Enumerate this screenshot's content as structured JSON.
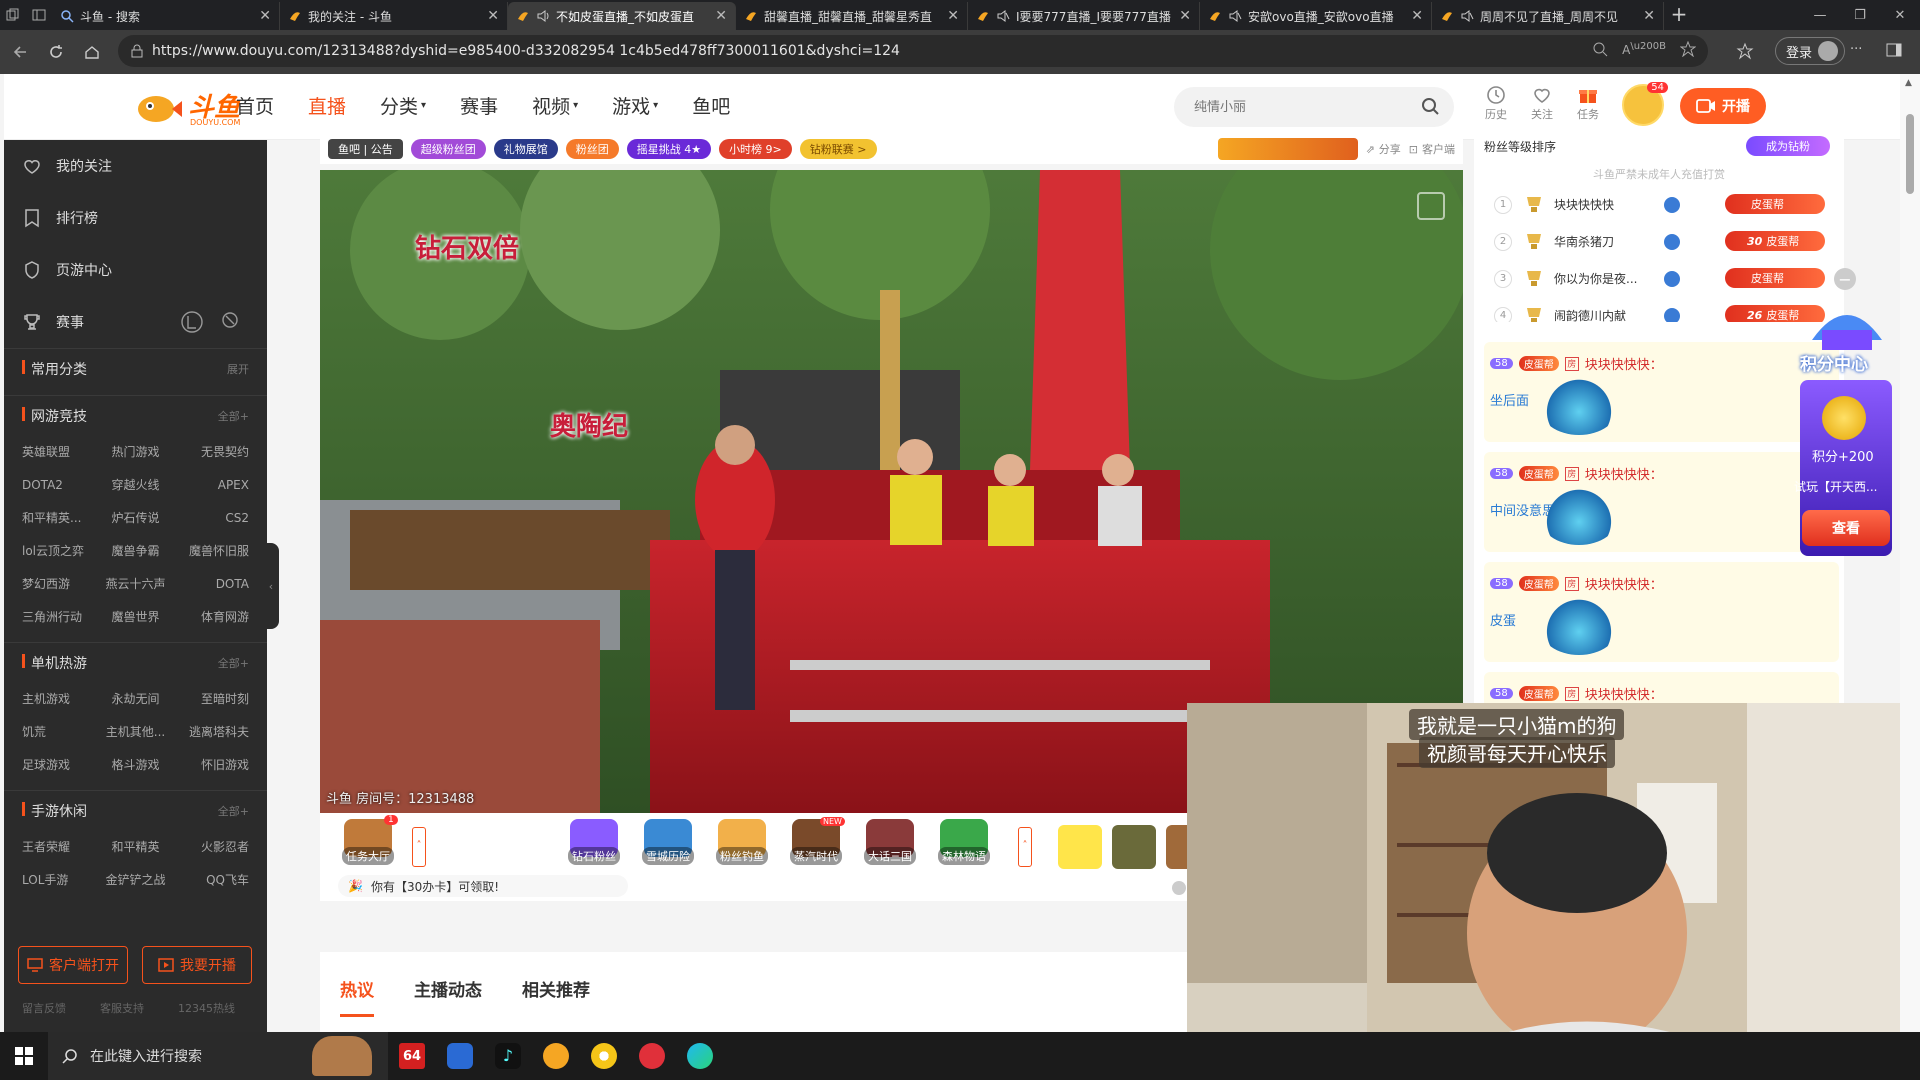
{
  "browser": {
    "tabs": [
      {
        "title": "斗鱼 - 搜索",
        "active": false
      },
      {
        "title": "我的关注 - 斗鱼",
        "active": false
      },
      {
        "title": "不如皮蛋直播_不如皮蛋直",
        "active": true
      },
      {
        "title": "甜馨直播_甜馨直播_甜馨星秀直",
        "active": false
      },
      {
        "title": "I要要777直播_I要要777直播",
        "active": false
      },
      {
        "title": "安歆ovo直播_安歆ovo直播",
        "active": false
      },
      {
        "title": "周周不见了直播_周周不见",
        "active": false
      }
    ],
    "url": "https://www.douyu.com/12313488?dyshid=e985400-d332082954 1c4b5ed478ff7300011601&dyshci=124",
    "login_label": "登录"
  },
  "site": {
    "logo_text": "斗鱼",
    "logo_sub": "DOUYU.COM",
    "nav": [
      {
        "label": "首页",
        "active": false,
        "caret": false
      },
      {
        "label": "直播",
        "active": true,
        "caret": false
      },
      {
        "label": "分类",
        "active": false,
        "caret": true
      },
      {
        "label": "赛事",
        "active": false,
        "caret": false
      },
      {
        "label": "视频",
        "active": false,
        "caret": true
      },
      {
        "label": "游戏",
        "active": false,
        "caret": true
      },
      {
        "label": "鱼吧",
        "active": false,
        "caret": false
      }
    ],
    "search_placeholder": "纯情小丽",
    "header_icons": [
      {
        "name": "history",
        "label": "历史"
      },
      {
        "name": "follow",
        "label": "关注"
      },
      {
        "name": "task",
        "label": "任务"
      }
    ],
    "avatar_badge": "54",
    "start_stream_label": "开播"
  },
  "sidebar": {
    "main_items": [
      {
        "name": "follow",
        "label": "我的关注"
      },
      {
        "name": "rank",
        "label": "排行榜"
      },
      {
        "name": "mobile-game",
        "label": "页游中心"
      },
      {
        "name": "match",
        "label": "赛事"
      }
    ],
    "common": {
      "title": "常用分类",
      "more": "展开"
    },
    "sections": [
      {
        "title": "网游竞技",
        "more": "全部+",
        "items": [
          "英雄联盟",
          "热门游戏",
          "无畏契约",
          "DOTA2",
          "穿越火线",
          "APEX",
          "和平精英...",
          "炉石传说",
          "CS2",
          "lol云顶之弈",
          "魔兽争霸",
          "魔兽怀旧服",
          "梦幻西游",
          "燕云十六声",
          "DOTA",
          "三角洲行动",
          "魔兽世界",
          "体育网游"
        ]
      },
      {
        "title": "单机热游",
        "more": "全部+",
        "items": [
          "主机游戏",
          "永劫无间",
          "至暗时刻",
          "饥荒",
          "主机其他...",
          "逃离塔科夫",
          "足球游戏",
          "格斗游戏",
          "怀旧游戏"
        ]
      },
      {
        "title": "手游休闲",
        "more": "全部+",
        "items": [
          "王者荣耀",
          "和平精英",
          "火影忍者",
          "LOL手游",
          "金铲铲之战",
          "QQ飞车"
        ]
      }
    ],
    "client_btn": "客户端打开",
    "start_btn": "我要开播",
    "footer": [
      "留言反馈",
      "客服支持",
      "12345热线"
    ]
  },
  "room": {
    "top_strip": {
      "fish_bar": "鱼吧",
      "notice": "公告",
      "pills": [
        "超级粉丝团",
        "礼物展馆",
        "粉丝团",
        "摇星挑战 4★",
        "小时榜 9>",
        "钻粉联赛 >"
      ],
      "share": "分享",
      "client": "客户端"
    },
    "video_caption_1": "钻石双倍",
    "video_caption_2": "奥陶纪",
    "room_no": "斗鱼 房间号：12313488",
    "gifts": [
      {
        "name": "task-hall",
        "label": "任务大厅",
        "color": "#c07a3a",
        "badge": "1"
      },
      {
        "name": "diamond-fans",
        "label": "钻石粉丝",
        "color": "#8a5cff"
      },
      {
        "name": "snow-city",
        "label": "雪城历险",
        "color": "#3a8ad4"
      },
      {
        "name": "fans-fishing",
        "label": "粉丝钓鱼",
        "color": "#f2b04a"
      },
      {
        "name": "steam-age",
        "label": "蒸汽时代",
        "color": "#7a4a2a",
        "badge": "NEW"
      },
      {
        "name": "three-kingdoms",
        "label": "大话三国",
        "color": "#8a3a3a"
      },
      {
        "name": "forest-story",
        "label": "森林物语",
        "color": "#3aa84a"
      }
    ],
    "claim_text": "你有【30办卡】可领取!",
    "content_tabs": [
      "热议",
      "主播动态",
      "相关推荐"
    ]
  },
  "rank_panel": {
    "title": "粉丝等级排序",
    "become_diamond": "成为钻粉",
    "note": "斗鱼严禁未成年人充值打赏",
    "rows": [
      {
        "rank": "1",
        "name": "块块快快快",
        "level": "",
        "fan_tag": "皮蛋帮"
      },
      {
        "rank": "2",
        "name": "华南杀猪刀",
        "level": "30",
        "fan_tag": "皮蛋帮"
      },
      {
        "rank": "3",
        "name": "你以为你是夜...",
        "level": "",
        "fan_tag": "皮蛋帮"
      },
      {
        "rank": "4",
        "name": "闹韵德川内献",
        "level": "26",
        "fan_tag": "皮蛋帮"
      }
    ]
  },
  "chat": [
    {
      "level": "58",
      "fan": "皮蛋帮",
      "user": "块块快快快：",
      "msg": "坐后面"
    },
    {
      "level": "58",
      "fan": "皮蛋帮",
      "user": "块块快快快：",
      "msg": "中间没意思"
    },
    {
      "level": "58",
      "fan": "皮蛋帮",
      "user": "块块快快快：",
      "msg": "皮蛋"
    },
    {
      "level": "58",
      "fan": "皮蛋帮",
      "user": "块块快快快：",
      "msg": ""
    }
  ],
  "points_widget": {
    "title": "积分中心",
    "points": "积分+200",
    "desc": "试玩【开天西...",
    "view_btn": "查看",
    "room_tag": "房"
  },
  "webcam": {
    "line1": "我就是一只小猫m的狗",
    "line2": "祝颜哥每天开心快乐"
  },
  "taskbar": {
    "search_placeholder": "在此键入进行搜索",
    "apps": [
      {
        "name": "app-64",
        "label": "64"
      },
      {
        "name": "app-blue"
      },
      {
        "name": "app-tiktok"
      },
      {
        "name": "app-red"
      },
      {
        "name": "app-chrome"
      },
      {
        "name": "app-pink"
      },
      {
        "name": "app-edge"
      }
    ]
  }
}
